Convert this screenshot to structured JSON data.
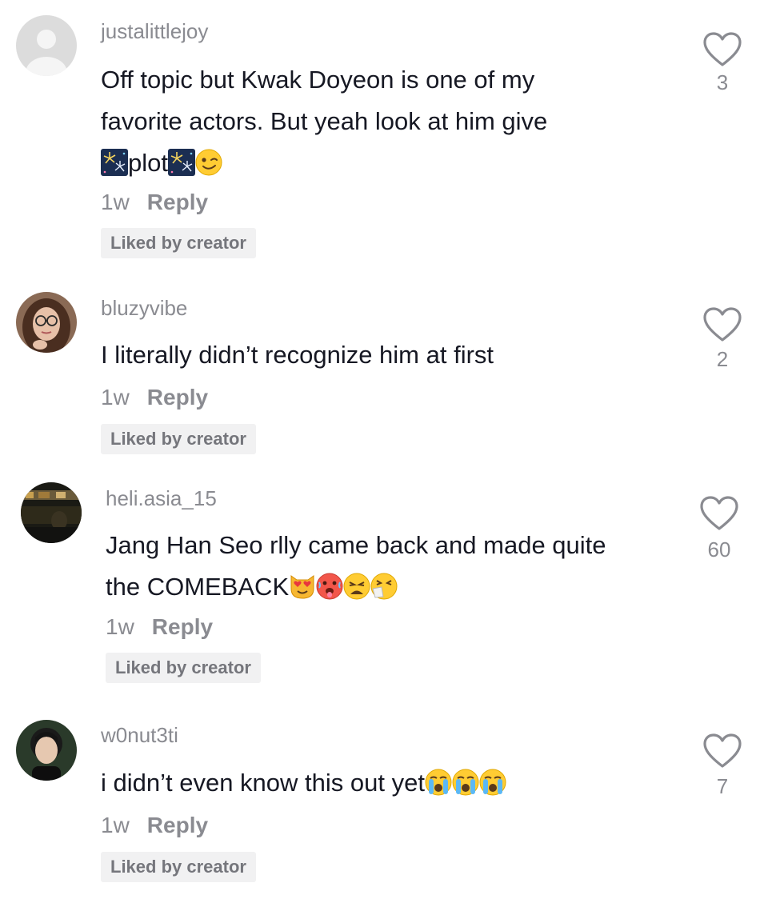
{
  "comments": [
    {
      "username": "justalittlejoy",
      "text_lines": [
        "Off topic but Kwak Doyeon is one of my",
        "favorite actors. But yeah look at him give"
      ],
      "text_tail": "plot",
      "emoji": [
        "fireworks",
        "fireworks",
        "winking-face"
      ],
      "time": "1w",
      "reply_label": "Reply",
      "badge": "Liked by creator",
      "likes": "3",
      "avatar": "default-avatar"
    },
    {
      "username": "bluzyvibe",
      "text_lines": [
        "I literally didn’t recognize him at first"
      ],
      "time": "1w",
      "reply_label": "Reply",
      "badge": "Liked by creator",
      "likes": "2",
      "avatar": "woman-with-glasses-photo"
    },
    {
      "username": "heli.asia_15",
      "text_lines": [
        "Jang Han Seo rlly came back and made quite",
        "the COMEBACK"
      ],
      "emoji": [
        "heart-eyes-cat",
        "hot-face",
        "weary-face",
        "sneezing-face"
      ],
      "time": "1w",
      "reply_label": "Reply",
      "badge": "Liked by creator",
      "likes": "60",
      "avatar": "dark-scene-photo"
    },
    {
      "username": "w0nut3ti",
      "text_lines": [
        "i didn’t even know this out yet"
      ],
      "emoji": [
        "loudly-crying-face",
        "loudly-crying-face",
        "loudly-crying-face"
      ],
      "time": "1w",
      "reply_label": "Reply",
      "badge": "Liked by creator",
      "likes": "7",
      "avatar": "young-man-photo"
    }
  ],
  "colors": {
    "text_primary": "#161823",
    "text_secondary": "#8a8b91",
    "badge_bg": "#f1f1f2"
  }
}
